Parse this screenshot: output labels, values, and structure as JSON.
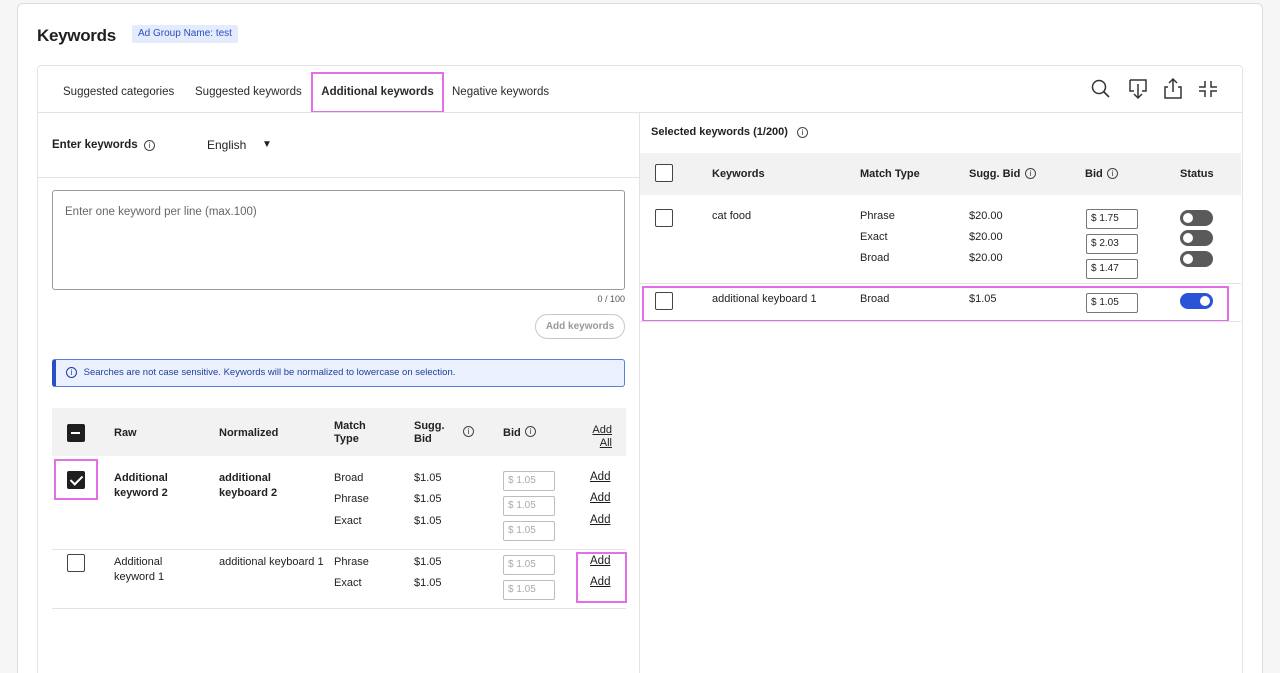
{
  "header": {
    "title": "Keywords",
    "adgroup_badge": "Ad Group Name: test"
  },
  "tabs": [
    {
      "label": "Suggested categories"
    },
    {
      "label": "Suggested keywords"
    },
    {
      "label": "Additional keywords",
      "active": true
    },
    {
      "label": "Negative keywords"
    }
  ],
  "toolbar_icons": [
    "search-icon",
    "download-icon",
    "upload-icon",
    "collapse-icon"
  ],
  "entry": {
    "label": "Enter keywords",
    "language": "English",
    "placeholder": "Enter one keyword per line (max.100)",
    "char_count": "0 / 100",
    "add_button": "Add keywords",
    "notice": "Searches are not case sensitive. Keywords will be normalized to lowercase on selection."
  },
  "results_table": {
    "headers": {
      "raw": "Raw",
      "normalized": "Normalized",
      "match_type": "Match Type",
      "sugg_bid": "Sugg. Bid",
      "bid": "Bid",
      "add_all": "Add All"
    },
    "rows": [
      {
        "checked": true,
        "raw": "Additional keyword 2",
        "normalized": "additional keyboard 2",
        "bold": true,
        "matches": [
          {
            "type": "Broad",
            "sugg": "$1.05",
            "bid": "1.05",
            "action": "Add"
          },
          {
            "type": "Phrase",
            "sugg": "$1.05",
            "bid": "1.05",
            "action": "Add"
          },
          {
            "type": "Exact",
            "sugg": "$1.05",
            "bid": "1.05",
            "action": "Add"
          }
        ]
      },
      {
        "checked": false,
        "raw": "Additional keyword 1",
        "normalized": "additional keyboard 1",
        "bold": false,
        "matches": [
          {
            "type": "Phrase",
            "sugg": "$1.05",
            "bid": "1.05",
            "action": "Add"
          },
          {
            "type": "Exact",
            "sugg": "$1.05",
            "bid": "1.05",
            "action": "Add"
          }
        ]
      }
    ]
  },
  "selected": {
    "title": "Selected keywords (1/200)",
    "headers": {
      "keywords": "Keywords",
      "match_type": "Match Type",
      "sugg_bid": "Sugg. Bid",
      "bid": "Bid",
      "status": "Status"
    },
    "rows": [
      {
        "keyword": "cat food",
        "matches": [
          {
            "type": "Phrase",
            "sugg": "$20.00",
            "bid": "1.75",
            "status": "off"
          },
          {
            "type": "Exact",
            "sugg": "$20.00",
            "bid": "2.03",
            "status": "off"
          },
          {
            "type": "Broad",
            "sugg": "$20.00",
            "bid": "1.47",
            "status": "off"
          }
        ]
      },
      {
        "keyword": "additional keyboard 1",
        "matches": [
          {
            "type": "Broad",
            "sugg": "$1.05",
            "bid": "1.05",
            "status": "on"
          }
        ]
      }
    ]
  },
  "currency_symbol": "$",
  "info_symbol": "i",
  "caret_symbol": "▼",
  "highlight_color": "#e26fe6",
  "toggle_on_color": "#2a54d6"
}
